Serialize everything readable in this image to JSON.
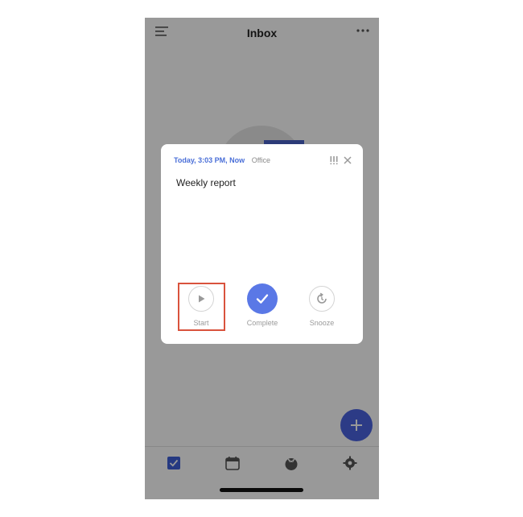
{
  "header": {
    "title": "Inbox",
    "menu_icon": "menu-icon",
    "more_icon": "more-horizontal-icon"
  },
  "modal": {
    "date": "Today, 3:03 PM, Now",
    "project": "Office",
    "priority_icon": "priority-icon",
    "close_icon": "close-icon",
    "task_title": "Weekly report",
    "actions": [
      {
        "label": "Start",
        "icon": "play-icon"
      },
      {
        "label": "Complete",
        "icon": "checkmark-icon"
      },
      {
        "label": "Snooze",
        "icon": "snooze-icon"
      }
    ]
  },
  "fab": {
    "icon": "plus-icon"
  },
  "tabbar": {
    "items": [
      {
        "icon": "tasks-checkbox-icon",
        "active": true
      },
      {
        "icon": "calendar-icon",
        "active": false
      },
      {
        "icon": "pomodoro-icon",
        "active": false
      },
      {
        "icon": "settings-gear-icon",
        "active": false
      }
    ]
  },
  "colors": {
    "accent": "#5a78e6",
    "date_text": "#4a6fd8",
    "highlight_box": "#d9533d"
  }
}
